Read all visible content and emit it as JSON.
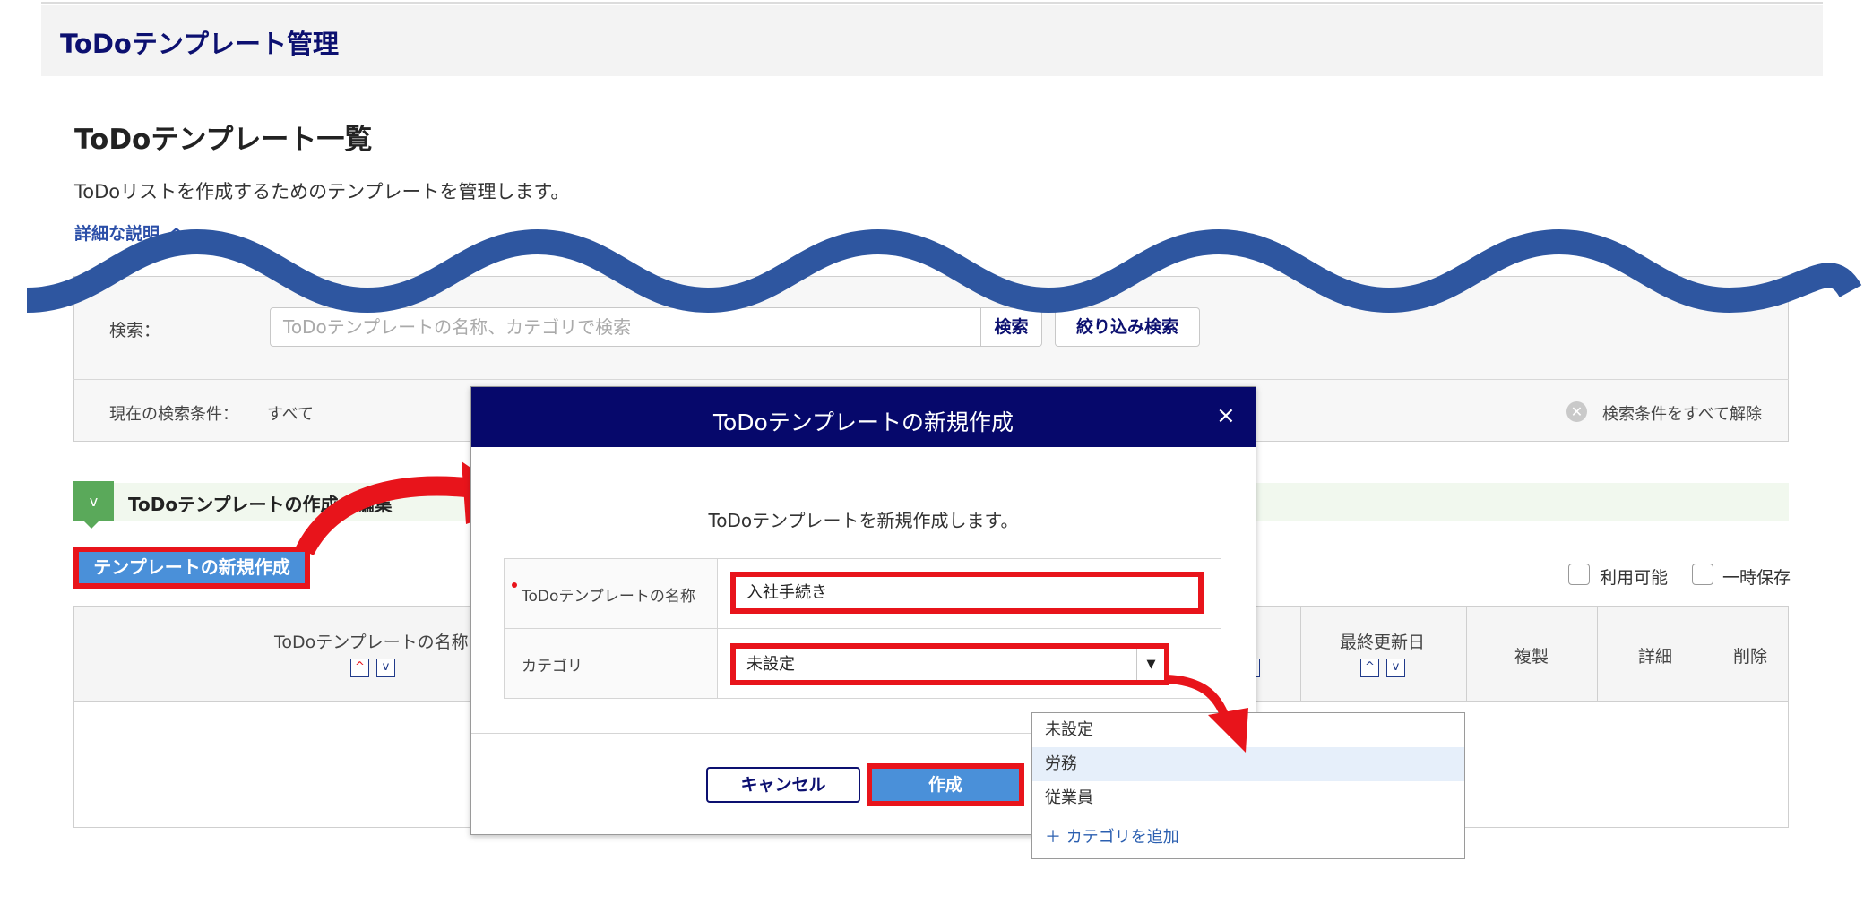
{
  "app": {
    "title": "ToDoテンプレート管理"
  },
  "page": {
    "title": "ToDoテンプレート一覧",
    "description": "ToDoリストを作成するためのテンプレートを管理します。",
    "detail_link": "詳細な説明"
  },
  "search": {
    "label": "検索：",
    "placeholder": "ToDoテンプレートの名称、カテゴリで検索",
    "search_button": "検索",
    "filter_button": "絞り込み検索",
    "current_label": "現在の検索条件：",
    "current_value": "すべて",
    "clear_label": "検索条件をすべて解除"
  },
  "info": {
    "text": "ToDoテンプレートの作成・編集"
  },
  "actions": {
    "create_button": "テンプレートの新規作成"
  },
  "filters": {
    "available": "利用可能",
    "draft": "一時保存"
  },
  "table": {
    "headers": {
      "name": "ToDoテンプレートの名称",
      "updated": "最終更新日",
      "duplicate": "複製",
      "detail": "詳細",
      "delete": "削除"
    }
  },
  "modal": {
    "title": "ToDoテンプレートの新規作成",
    "close": "×",
    "description": "ToDoテンプレートを新規作成します。",
    "name_label": "ToDoテンプレートの名称",
    "name_value": "入社手続き",
    "category_label": "カテゴリ",
    "category_value": "未設定",
    "cancel_button": "キャンセル",
    "submit_button": "作成"
  },
  "dropdown": {
    "options": [
      "未設定",
      "労務",
      "従業員"
    ],
    "highlighted": "労務",
    "add_label": "カテゴリを追加"
  },
  "colors": {
    "brand_navy": "#06086b",
    "primary_blue": "#4a90d9",
    "annotation_red": "#e8141b",
    "wave": "#2e56a0"
  }
}
